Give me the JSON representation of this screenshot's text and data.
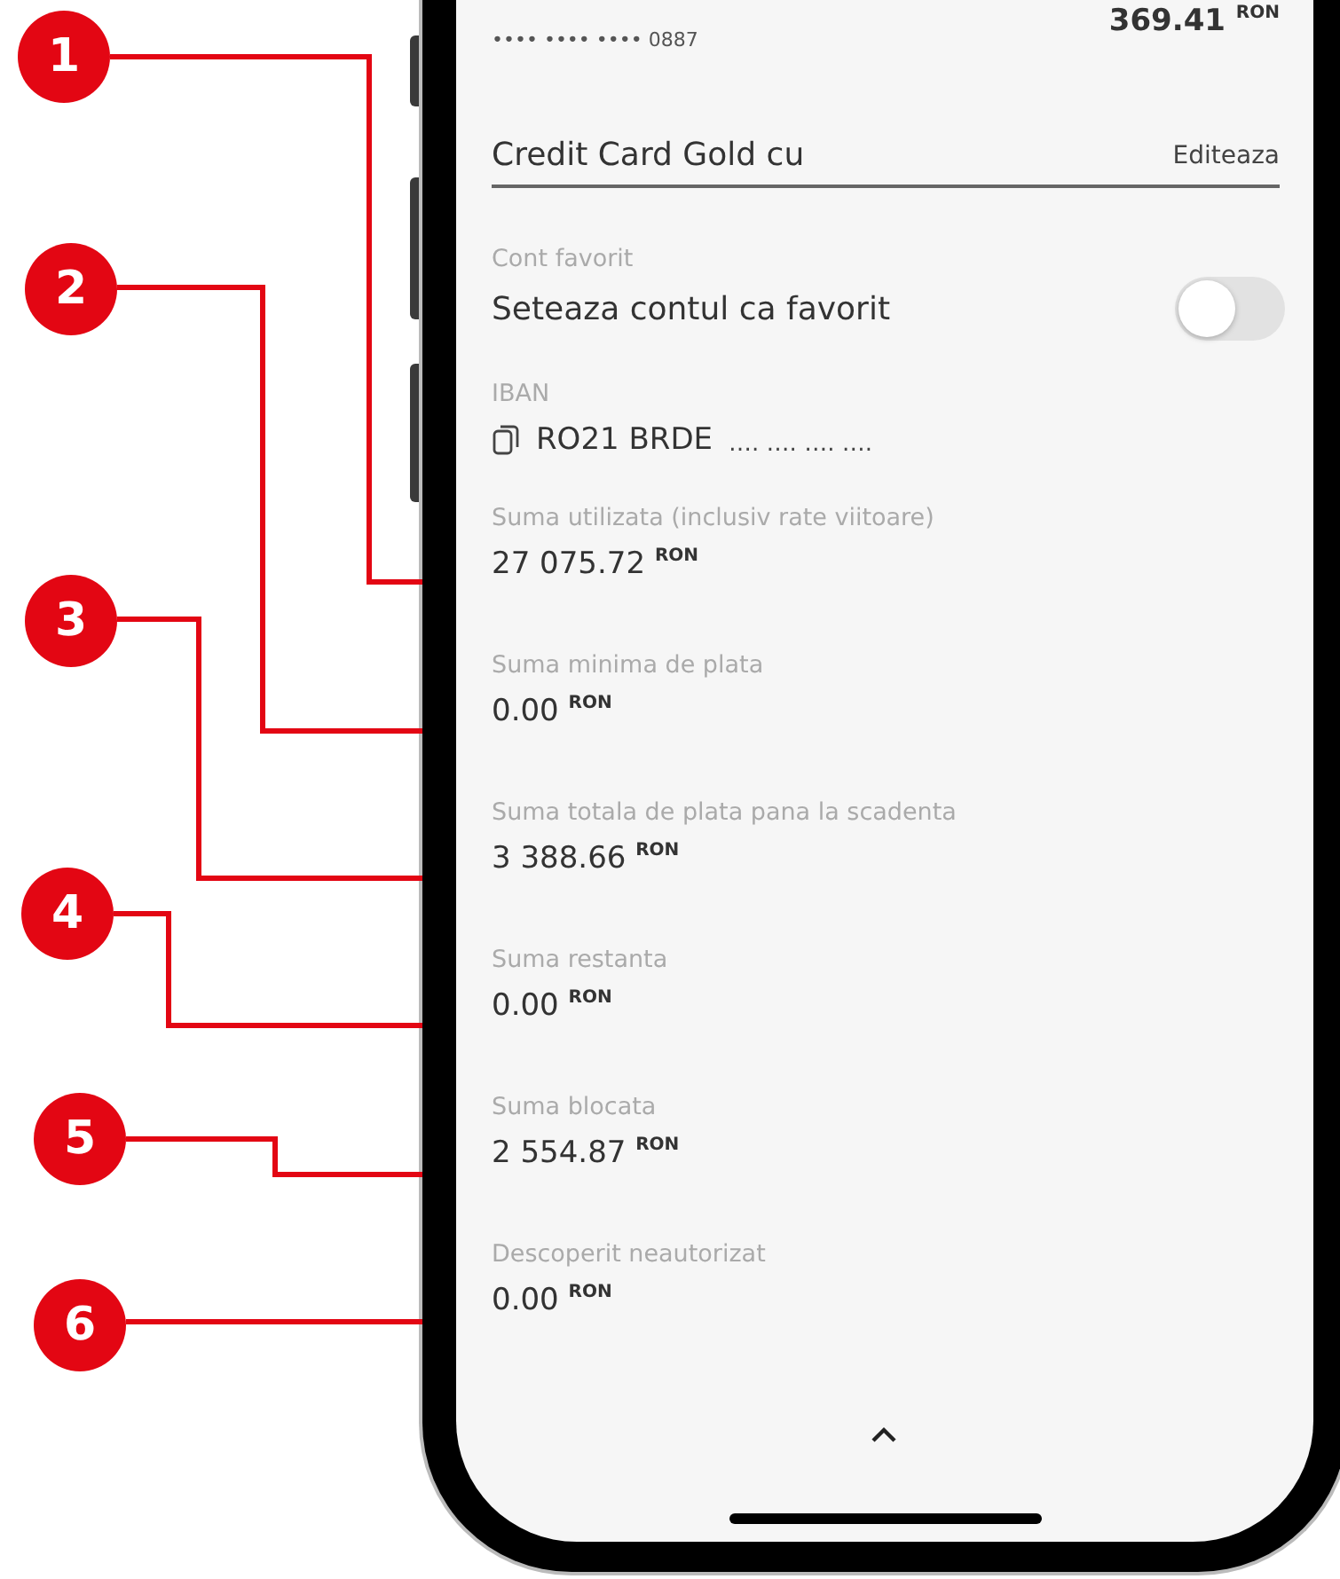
{
  "card": {
    "masked_number": "•••• •••• •••• 0887",
    "amount": "369.41",
    "currency": "RON"
  },
  "name_field": {
    "value": "Credit Card Gold cu",
    "action": "Editeaza"
  },
  "favorite": {
    "label": "Cont favorit",
    "text": "Seteaza contul ca favorit",
    "on": false
  },
  "iban": {
    "label": "IBAN",
    "value": "RO21 BRDE",
    "masked": "…. …. …. …."
  },
  "details": [
    {
      "label": "Suma utilizata (inclusiv rate viitoare)",
      "amount": "27 075.72",
      "currency": "RON"
    },
    {
      "label": "Suma minima de plata",
      "amount": "0.00",
      "currency": "RON"
    },
    {
      "label": "Suma totala de plata pana la scadenta",
      "amount": "3 388.66",
      "currency": "RON"
    },
    {
      "label": "Suma restanta",
      "amount": "0.00",
      "currency": "RON"
    },
    {
      "label": "Suma blocata",
      "amount": "2 554.87",
      "currency": "RON"
    },
    {
      "label": "Descoperit neautorizat",
      "amount": "0.00",
      "currency": "RON"
    }
  ],
  "callouts": [
    {
      "number": "1"
    },
    {
      "number": "2"
    },
    {
      "number": "3"
    },
    {
      "number": "4"
    },
    {
      "number": "5"
    },
    {
      "number": "6"
    }
  ]
}
